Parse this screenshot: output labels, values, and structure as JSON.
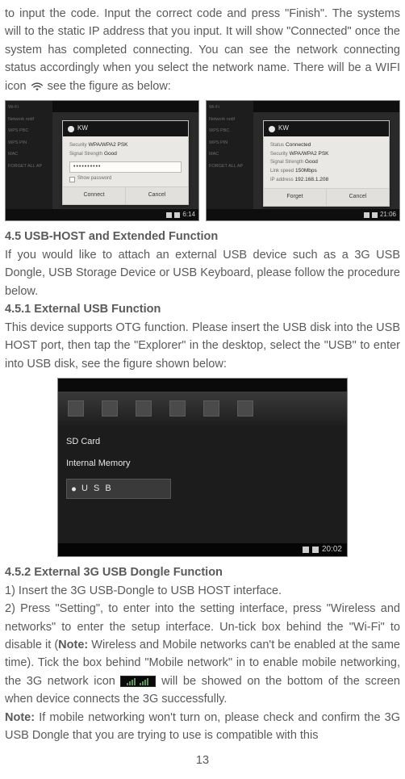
{
  "top_para": "to input the code. Input the correct code and press \"Finish\". The systems will to the static IP address that you input. It will show \"Connected\" once the system has completed connecting. You can see the network connecting status accordingly when you select the network name. There will be a WIFI icon ",
  "top_para_tail": " see the figure as below:",
  "sc1": {
    "left_items": [
      "Wi-Fi",
      "Network notif",
      "WPS PBC",
      "WPS PIN",
      "MAC",
      "FORGET ALL AP"
    ],
    "dialog_title": "KW",
    "sec_label": "Security",
    "sec_value": "WPA/WPA2 PSK",
    "sig_label": "Signal Strength",
    "sig_value": "Good",
    "pw_value": "••••••••••",
    "show_pw": "Show password",
    "btn_ok": "Connect",
    "btn_cancel": "Cancel",
    "time": "6:14"
  },
  "sc2": {
    "left_items": [
      "Wi-Fi",
      "Network notif",
      "WPS PBC",
      "WPS PIN",
      "MAC",
      "FORGET ALL AP"
    ],
    "dialog_title": "KW",
    "status_label": "Status",
    "status_value": "Connected",
    "sec_label": "Security",
    "sec_value": "WPA/WPA2 PSK",
    "sig_label": "Signal Strength",
    "sig_value": "Good",
    "speed_label": "Link speed",
    "speed_value": "150Mbps",
    "ip_label": "IP address",
    "ip_value": "192.168.1.208",
    "btn_forget": "Forget",
    "btn_cancel": "Cancel",
    "time": "21:06"
  },
  "h45": "4.5 USB-HOST and Extended Function",
  "p45": "If you would like to attach an external USB device such as a 3G USB Dongle, USB Storage Device or USB Keyboard, please follow the procedure below.",
  "h451": "4.5.1 External USB Function",
  "p451": "This device supports OTG function. Please insert the USB disk into the USB HOST port, then tap the \"Explorer\" in the desktop, select the \"USB\" to enter into USB disk, see the figure shown below:",
  "big": {
    "items": [
      "SD Card",
      "Internal Memory",
      "U S B"
    ],
    "time": "20:02"
  },
  "h452": "4.5.2 External 3G USB Dongle Function",
  "p452_1": "1) Insert the 3G USB-Dongle to USB HOST interface.",
  "p452_2a": "2) Press \"Setting\", to enter into the setting interface, press \"Wireless and networks\" to enter the setup interface. Un-tick box behind the \"Wi-Fi\" to disable it (",
  "note_word": "Note:",
  "p452_2b": " Wireless and Mobile networks can't be enabled at the same time). Tick the box behind \"Mobile network\" in to enable mobile networking, the 3G network icon ",
  "p452_2c": " will be showed on the bottom of the screen when device connects the 3G successfully.",
  "p452_note": " If mobile networking won't turn on, please check and confirm the 3G USB Dongle that you are trying to use is compatible with this",
  "page_number": "13"
}
